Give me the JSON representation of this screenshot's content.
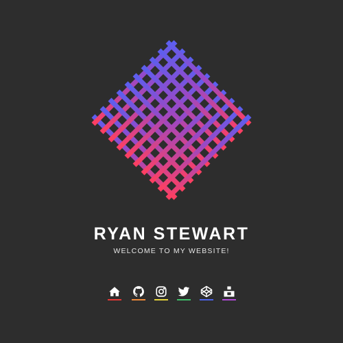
{
  "site": {
    "name": "RYAN STEWART",
    "tagline": "WELCOME TO MY WEBSITE!"
  },
  "logo": {
    "gradient_top": "#5b5ff0",
    "gradient_bottom": "#ff3f60"
  },
  "social": [
    {
      "icon": "home-icon",
      "accent": "#e53935"
    },
    {
      "icon": "github-icon",
      "accent": "#ef8a3a"
    },
    {
      "icon": "instagram-icon",
      "accent": "#e6d53c"
    },
    {
      "icon": "twitter-icon",
      "accent": "#3fbf6a"
    },
    {
      "icon": "codepen-icon",
      "accent": "#4d63e8"
    },
    {
      "icon": "dev-icon",
      "accent": "#b04ad6"
    }
  ]
}
